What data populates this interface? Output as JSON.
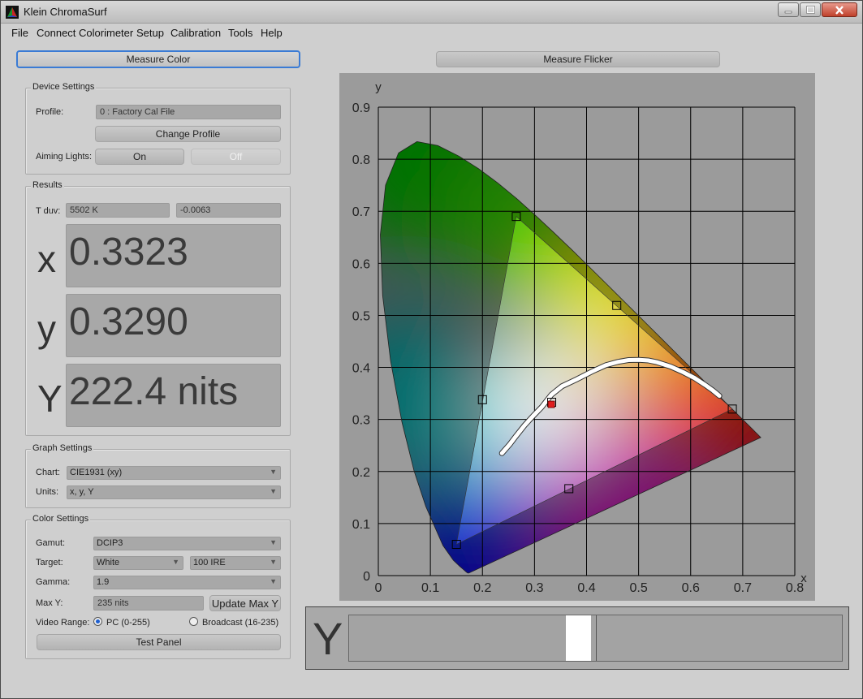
{
  "window": {
    "title": "Klein ChromaSurf"
  },
  "menu": [
    "File",
    "Connect Colorimeter",
    "Setup",
    "Calibration",
    "Tools",
    "Help"
  ],
  "top_buttons": {
    "measure_color": "Measure Color",
    "measure_flicker": "Measure Flicker"
  },
  "device_settings": {
    "title": "Device Settings",
    "profile_label": "Profile:",
    "profile_value": "0 : Factory Cal File",
    "change_profile": "Change Profile",
    "aiming_label": "Aiming Lights:",
    "on_label": "On",
    "off_label": "Off"
  },
  "results": {
    "title": "Results",
    "tduv_label": "T duv:",
    "t_value": "5502 K",
    "duv_value": "-0.0063",
    "x_letter": "x",
    "x_value": "0.3323",
    "y_letter": "y",
    "y_value": "0.3290",
    "Y_letter": "Y",
    "Y_value": "222.4 nits"
  },
  "graph_settings": {
    "title": "Graph Settings",
    "chart_label": "Chart:",
    "chart_value": "CIE1931 (xy)",
    "units_label": "Units:",
    "units_value": "x, y, Y"
  },
  "color_settings": {
    "title": "Color Settings",
    "gamut_label": "Gamut:",
    "gamut_value": "DCIP3",
    "target_label": "Target:",
    "target_value": "White",
    "target_level": "100 IRE",
    "gamma_label": "Gamma:",
    "gamma_value": "1.9",
    "maxy_label": "Max Y:",
    "maxy_value": "235 nits",
    "update_maxy": "Update Max Y",
    "video_range_label": "Video Range:",
    "pc_range": "PC (0-255)",
    "broadcast_range": "Broadcast (16-235)",
    "pc_selected": true,
    "test_panel": "Test Panel"
  },
  "chart_data": {
    "type": "scatter",
    "title": "",
    "xlabel": "x",
    "ylabel": "y",
    "xlim": [
      0,
      0.8
    ],
    "ylim": [
      0,
      0.9
    ],
    "x_ticks": [
      "0",
      "0.1",
      "0.2",
      "0.3",
      "0.4",
      "0.5",
      "0.6",
      "0.7",
      "0.8"
    ],
    "y_ticks": [
      "0",
      "0.1",
      "0.2",
      "0.3",
      "0.4",
      "0.5",
      "0.6",
      "0.7",
      "0.8",
      "0.9"
    ],
    "grid": true,
    "gamut_triangle": [
      [
        0.68,
        0.32
      ],
      [
        0.265,
        0.69
      ],
      [
        0.15,
        0.06
      ]
    ],
    "target_markers": [
      [
        0.68,
        0.32
      ],
      [
        0.265,
        0.69
      ],
      [
        0.15,
        0.06
      ],
      [
        0.2,
        0.338
      ],
      [
        0.458,
        0.519
      ],
      [
        0.366,
        0.167
      ],
      [
        0.333,
        0.333
      ]
    ],
    "measured_point": [
      0.3323,
      0.329
    ],
    "measured_color": "#e01e1e",
    "spectral_locus": [
      [
        0.1741,
        0.005
      ],
      [
        0.1738,
        0.0049
      ],
      [
        0.1733,
        0.0048
      ],
      [
        0.1726,
        0.0048
      ],
      [
        0.1714,
        0.0051
      ],
      [
        0.1689,
        0.0069
      ],
      [
        0.1644,
        0.0109
      ],
      [
        0.1566,
        0.0177
      ],
      [
        0.144,
        0.0297
      ],
      [
        0.1241,
        0.0578
      ],
      [
        0.0913,
        0.1327
      ],
      [
        0.0687,
        0.2007
      ],
      [
        0.0454,
        0.295
      ],
      [
        0.0235,
        0.4127
      ],
      [
        0.0082,
        0.5384
      ],
      [
        0.0039,
        0.6548
      ],
      [
        0.0139,
        0.7502
      ],
      [
        0.0389,
        0.812
      ],
      [
        0.0743,
        0.8338
      ],
      [
        0.1142,
        0.8262
      ],
      [
        0.1547,
        0.8059
      ],
      [
        0.1929,
        0.7816
      ],
      [
        0.2296,
        0.7543
      ],
      [
        0.2658,
        0.7243
      ],
      [
        0.3016,
        0.6923
      ],
      [
        0.3373,
        0.6589
      ],
      [
        0.3731,
        0.6245
      ],
      [
        0.4087,
        0.5896
      ],
      [
        0.4441,
        0.5547
      ],
      [
        0.4788,
        0.5202
      ],
      [
        0.5125,
        0.4866
      ],
      [
        0.5448,
        0.4544
      ],
      [
        0.5752,
        0.4242
      ],
      [
        0.6029,
        0.3965
      ],
      [
        0.627,
        0.3725
      ],
      [
        0.6482,
        0.3514
      ],
      [
        0.6658,
        0.334
      ],
      [
        0.6801,
        0.3197
      ],
      [
        0.6915,
        0.3083
      ],
      [
        0.7006,
        0.2993
      ],
      [
        0.714,
        0.2859
      ],
      [
        0.7347,
        0.2653
      ]
    ],
    "planckian_locus": [
      [
        0.2373,
        0.2351
      ],
      [
        0.2525,
        0.2522
      ],
      [
        0.2637,
        0.267
      ],
      [
        0.2806,
        0.2883
      ],
      [
        0.2979,
        0.3073
      ],
      [
        0.3138,
        0.3236
      ],
      [
        0.3323,
        0.3474
      ],
      [
        0.3527,
        0.3638
      ],
      [
        0.3805,
        0.3768
      ],
      [
        0.4103,
        0.3922
      ],
      [
        0.4368,
        0.4041
      ],
      [
        0.4599,
        0.4106
      ],
      [
        0.4806,
        0.4141
      ],
      [
        0.5008,
        0.4145
      ],
      [
        0.5186,
        0.4133
      ],
      [
        0.5352,
        0.4099
      ],
      [
        0.5612,
        0.4017
      ],
      [
        0.5857,
        0.3907
      ],
      [
        0.6072,
        0.3797
      ],
      [
        0.6285,
        0.3657
      ],
      [
        0.6425,
        0.3558
      ],
      [
        0.6552,
        0.3454
      ]
    ]
  },
  "luminance_bar": {
    "letter": "Y",
    "current_fraction": 0.44,
    "target_fraction": 0.5
  }
}
